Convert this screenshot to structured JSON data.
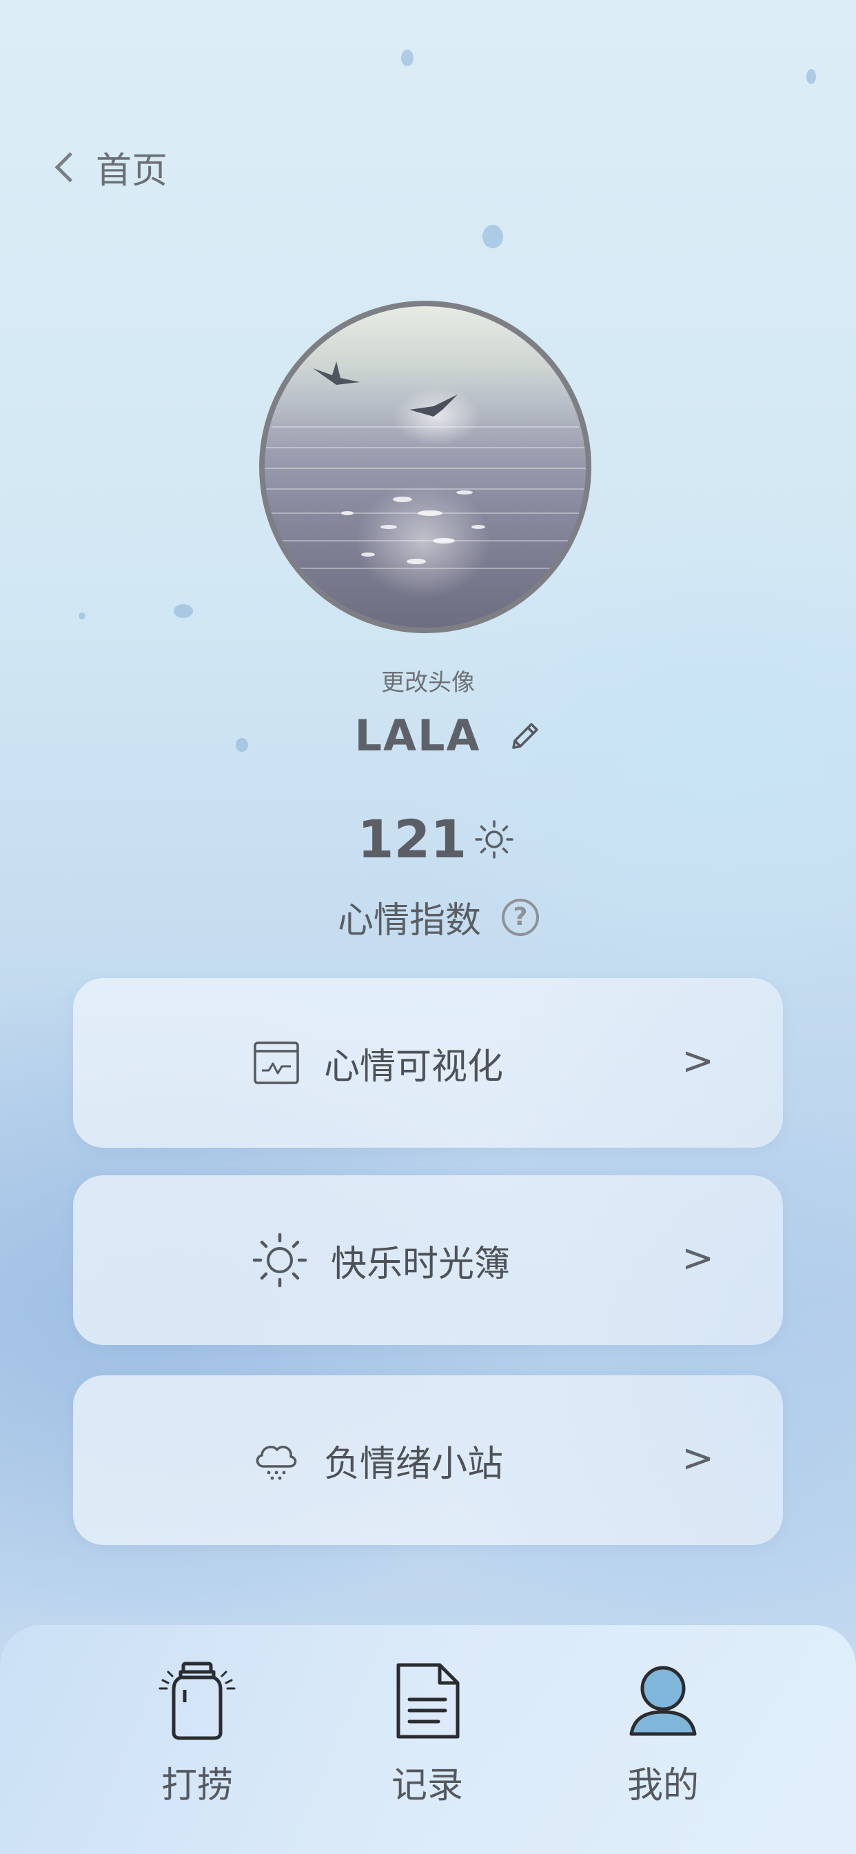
{
  "header": {
    "back_label": "首页"
  },
  "profile": {
    "change_avatar_label": "更改头像",
    "username": "LALA",
    "mood_score": "121",
    "mood_index_label": "心情指数",
    "help_symbol": "?"
  },
  "menu": {
    "items": [
      {
        "label": "心情可视化",
        "icon": "chart-window-icon",
        "arrow": ">"
      },
      {
        "label": "快乐时光簿",
        "icon": "sun-icon",
        "arrow": ">"
      },
      {
        "label": "负情绪小站",
        "icon": "rain-cloud-icon",
        "arrow": ">"
      }
    ]
  },
  "tabbar": {
    "tabs": [
      {
        "label": "打捞",
        "icon": "jar-icon",
        "active": false
      },
      {
        "label": "记录",
        "icon": "document-icon",
        "active": false
      },
      {
        "label": "我的",
        "icon": "user-icon",
        "active": true
      }
    ],
    "active_color": "#7fb6d9"
  }
}
